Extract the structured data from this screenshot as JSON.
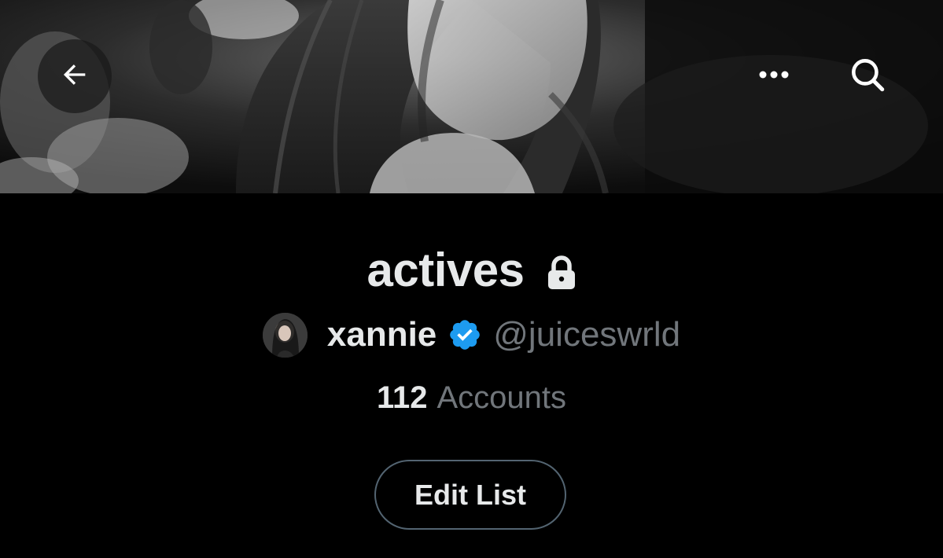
{
  "header": {
    "back_icon": "arrow-left-icon",
    "more_icon": "more-horizontal-icon",
    "search_icon": "search-icon"
  },
  "list": {
    "name": "actives",
    "privacy_icon": "lock-icon",
    "owner": {
      "display_name": "xannie",
      "verified_icon": "verified-badge-icon",
      "handle": "@juiceswrld"
    },
    "member_count": "112",
    "member_label": "Accounts",
    "edit_label": "Edit List"
  },
  "colors": {
    "background": "#000000",
    "text_primary": "#e7e9ea",
    "text_secondary": "#71767b",
    "verified_blue": "#1d9bf0",
    "button_border": "#536471"
  }
}
